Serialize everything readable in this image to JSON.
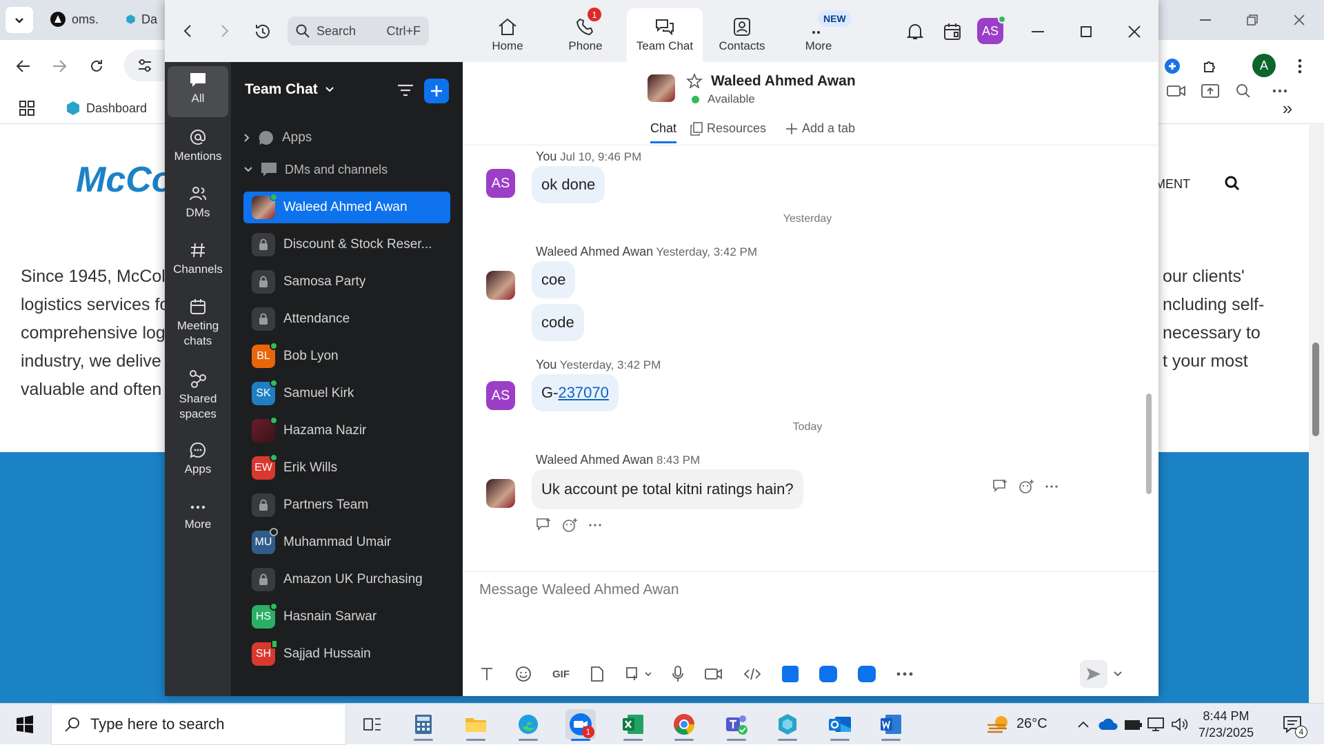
{
  "browser": {
    "tabs": [
      {
        "label": "oms."
      },
      {
        "label": "Da"
      }
    ],
    "bookmark": "Dashboard",
    "profile_initial": "A",
    "site_logo_text": "McCo",
    "site_nav_item": "MENT",
    "site_text_left": [
      "Since 1945, McColl",
      "logistics services fo",
      "comprehensive log",
      "industry, we delive",
      "valuable and often"
    ],
    "site_text_right": [
      "our clients'",
      "ncluding self-",
      "necessary to",
      "t your most"
    ]
  },
  "zoom": {
    "search": {
      "label": "Search",
      "shortcut": "Ctrl+F"
    },
    "nav": [
      {
        "label": "Home",
        "icon": "home-icon"
      },
      {
        "label": "Phone",
        "icon": "phone-icon",
        "badge": "1"
      },
      {
        "label": "Team Chat",
        "icon": "chat-icon",
        "active": true
      },
      {
        "label": "Contacts",
        "icon": "contacts-icon"
      },
      {
        "label": "More",
        "icon": "more-icon",
        "badge": "NEW"
      }
    ],
    "user_initials": "AS",
    "rail": [
      {
        "label": "All",
        "icon": "chat-bubble-icon"
      },
      {
        "label": "Mentions",
        "icon": "at-icon"
      },
      {
        "label": "DMs",
        "icon": "people-icon"
      },
      {
        "label": "Channels",
        "icon": "hash-icon"
      },
      {
        "label": "Meeting chats",
        "icon": "calendar-icon"
      },
      {
        "label": "Shared spaces",
        "icon": "share-icon"
      },
      {
        "label": "Apps",
        "icon": "apps-icon"
      },
      {
        "label": "More",
        "icon": "ellipsis-icon"
      }
    ],
    "chatlist": {
      "title": "Team Chat",
      "section_apps": "Apps",
      "section_dms": "DMs and channels",
      "items": [
        {
          "name": "Waleed Ahmed Awan",
          "type": "photo",
          "status": "online",
          "active": true
        },
        {
          "name": "Discount & Stock Reser...",
          "type": "lock"
        },
        {
          "name": "Samosa Party",
          "type": "lock"
        },
        {
          "name": "Attendance",
          "type": "lock"
        },
        {
          "name": "Bob Lyon",
          "type": "initials",
          "initials": "BL",
          "color": "#e8650a",
          "status": "online"
        },
        {
          "name": "Samuel Kirk",
          "type": "initials",
          "initials": "SK",
          "color": "#1e7fc4",
          "status": "online"
        },
        {
          "name": "Hazama Nazir",
          "type": "photo2",
          "status": "online"
        },
        {
          "name": "Erik Wills",
          "type": "initials",
          "initials": "EW",
          "color": "#d9382f",
          "status": "online"
        },
        {
          "name": "Partners Team",
          "type": "lock"
        },
        {
          "name": "Muhammad Umair",
          "type": "initials",
          "initials": "MU",
          "color": "#2f5d8a",
          "status": "offline"
        },
        {
          "name": "Amazon UK Purchasing",
          "type": "lock"
        },
        {
          "name": "Hasnain Sarwar",
          "type": "initials",
          "initials": "HS",
          "color": "#2bae66",
          "status": "online"
        },
        {
          "name": "Sajjad Hussain",
          "type": "initials",
          "initials": "SH",
          "color": "#d9382f",
          "status": "mobile"
        }
      ]
    },
    "chat": {
      "contact_name": "Waleed Ahmed Awan",
      "presence": "Available",
      "tabs": [
        "Chat",
        "Resources",
        "Add a tab"
      ],
      "messages": [
        {
          "sender": "You",
          "time": "Jul 10, 9:46 PM",
          "initials": "AS",
          "text": "ok done"
        },
        {
          "day": "Yesterday"
        },
        {
          "sender": "Waleed Ahmed Awan",
          "time": "Yesterday, 3:42 PM",
          "texts": [
            "coe",
            "code"
          ]
        },
        {
          "sender": "You",
          "time": "Yesterday, 3:42 PM",
          "initials": "AS",
          "text_prefix": "G-",
          "text_link": "237070"
        },
        {
          "day": "Today"
        },
        {
          "sender": "Waleed Ahmed Awan",
          "time": "8:43 PM",
          "text": "Uk account pe total kitni ratings hain?"
        }
      ],
      "composer_placeholder": "Message Waleed Ahmed Awan",
      "accent": "#0e72ed"
    }
  },
  "taskbar": {
    "search_placeholder": "Type here to search",
    "temperature": "26°C",
    "time": "8:44 PM",
    "date": "7/23/2025",
    "zoom_badge": "1",
    "notifications": "4"
  }
}
